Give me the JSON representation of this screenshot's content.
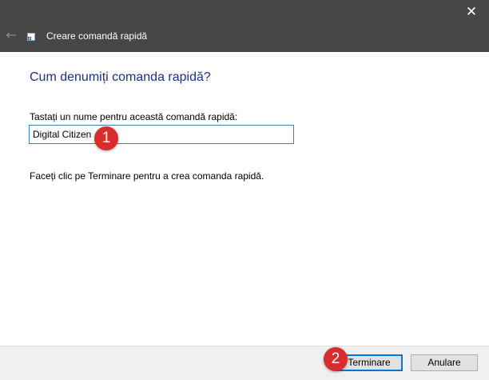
{
  "window": {
    "title": "Creare comandă rapidă",
    "close_glyph": "✕",
    "back_glyph": "←",
    "icons": {
      "close": "close-icon",
      "back": "arrow-left-icon",
      "app": "shortcut-icon"
    }
  },
  "wizard": {
    "heading": "Cum denumiți comanda rapidă?",
    "name_label": "Tastați un nume pentru această comandă rapidă:",
    "name_value": "Digital Citizen",
    "hint": "Faceți clic pe Terminare pentru a crea comanda rapidă."
  },
  "buttons": {
    "finish": "Terminare",
    "cancel": "Anulare"
  },
  "annotations": [
    {
      "label": "1"
    },
    {
      "label": "2"
    }
  ],
  "colors": {
    "titlebar": "#474747",
    "heading": "#1e3287",
    "input_border": "#3c7fb1",
    "primary_border": "#0078d7",
    "badge": "#d62e2e",
    "footer": "#f0f0f0"
  }
}
